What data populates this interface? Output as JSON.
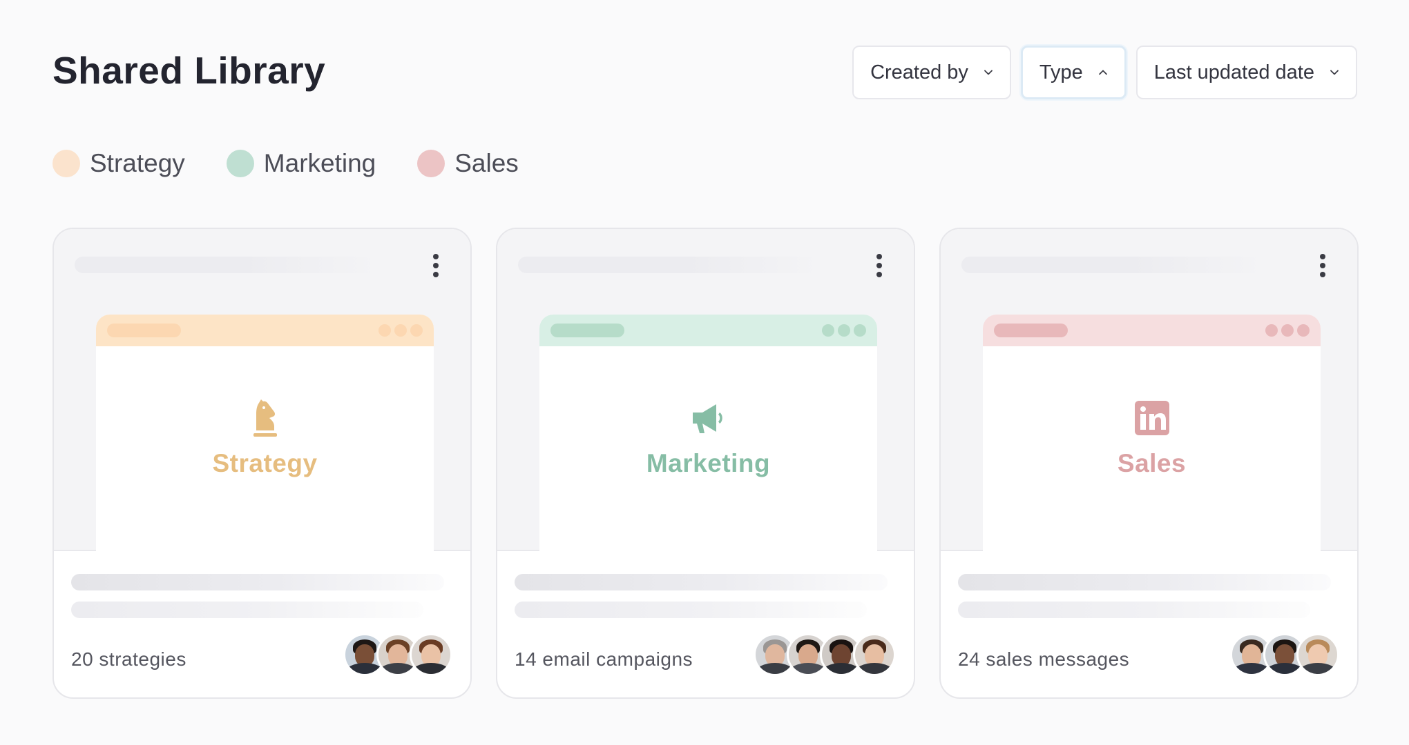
{
  "header": {
    "title": "Shared Library",
    "filters": [
      {
        "label": "Created by",
        "state": "collapsed"
      },
      {
        "label": "Type",
        "state": "expanded"
      },
      {
        "label": "Last updated date",
        "state": "collapsed"
      }
    ]
  },
  "legend": [
    {
      "label": "Strategy",
      "color": "#fbe3cd"
    },
    {
      "label": "Marketing",
      "color": "#bfdfd2"
    },
    {
      "label": "Sales",
      "color": "#ecc4c5"
    }
  ],
  "cards": [
    {
      "label": "Strategy",
      "count": "20 strategies",
      "icon": "chess-knight-icon",
      "accent": "#e6bd7f",
      "bar_color": "#fde4c6",
      "pill_color": "#fcd7b1",
      "avatars": [
        "avatar-1",
        "avatar-2",
        "avatar-3"
      ]
    },
    {
      "label": "Marketing",
      "count": "14 email campaigns",
      "icon": "megaphone-icon",
      "accent": "#86bda5",
      "bar_color": "#d8efe5",
      "pill_color": "#b6dcc9",
      "avatars": [
        "avatar-1",
        "avatar-2",
        "avatar-3",
        "avatar-4"
      ]
    },
    {
      "label": "Sales",
      "count": "24 sales messages",
      "icon": "linkedin-icon",
      "accent": "#dba2a4",
      "bar_color": "#f6dedf",
      "pill_color": "#e8b8ba",
      "avatars": [
        "avatar-1",
        "avatar-2",
        "avatar-3"
      ]
    }
  ]
}
